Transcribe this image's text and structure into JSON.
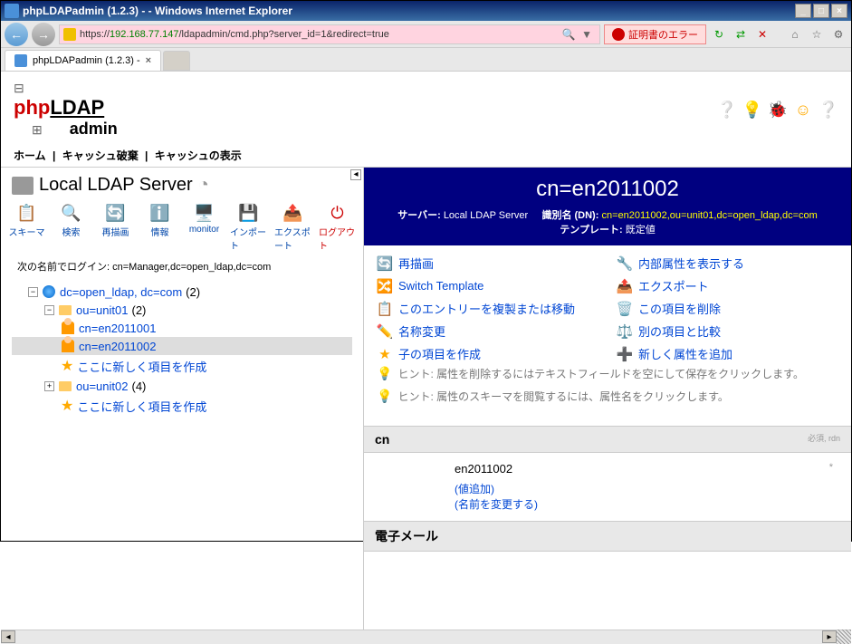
{
  "window": {
    "title": "phpLDAPadmin (1.2.3) -  - Windows Internet Explorer",
    "minimize": "_",
    "maximize": "□",
    "close": "×"
  },
  "nav": {
    "back": "←",
    "forward": "→",
    "url_prefix": "https://",
    "url_host": "192.168.77.147",
    "url_path": "/ldapadmin/cmd.php?server_id=1&redirect=true",
    "cert_error": "証明書のエラー"
  },
  "tab": {
    "title": "phpLDAPadmin (1.2.3) - ",
    "close": "×"
  },
  "logo": {
    "php": "php",
    "ldap": "LDAP",
    "admin": "admin"
  },
  "navlinks": {
    "home": "ホーム",
    "purge": "キャッシュ破棄",
    "show": "キャッシュの表示"
  },
  "server": {
    "title": "Local LDAP Server"
  },
  "toolbar": {
    "schema": "スキーマ",
    "search": "検索",
    "refresh": "再描画",
    "info": "情報",
    "monitor": "monitor",
    "import": "インポート",
    "export": "エクスポート",
    "logout": "ログアウト"
  },
  "login_info": "次の名前でログイン: cn=Manager,dc=open_ldap,dc=com",
  "tree": {
    "root": "dc=open_ldap, dc=com",
    "root_count": "(2)",
    "unit01": "ou=unit01",
    "unit01_count": "(2)",
    "cn1": "cn=en2011001",
    "cn2": "cn=en2011002",
    "create1": "ここに新しく項目を作成",
    "unit02": "ou=unit02",
    "unit02_count": "(4)",
    "create2": "ここに新しく項目を作成"
  },
  "dn": {
    "title": "cn=en2011002",
    "server_label": "サーバー:",
    "server_value": "Local LDAP Server",
    "dn_label": "識別名 (DN):",
    "dn_value": "cn=en2011002,ou=unit01,dc=open_ldap,dc=com",
    "template_label": "テンプレート:",
    "template_value": "既定値"
  },
  "actions": {
    "refresh": "再描画",
    "internal": "内部属性を表示する",
    "switch": "Switch Template",
    "export": "エクスポート",
    "copy": "このエントリーを複製または移動",
    "delete": "この項目を削除",
    "rename": "名称変更",
    "compare": "別の項目と比較",
    "child": "子の項目を作成",
    "addattr": "新しく属性を追加"
  },
  "hints": {
    "h1": "ヒント: 属性を削除するにはテキストフィールドを空にして保存をクリックします。",
    "h2": "ヒント: 属性のスキーマを閲覧するには、属性名をクリックします。"
  },
  "attrs": {
    "cn_label": "cn",
    "cn_meta": "必須, rdn",
    "cn_value": "en2011002",
    "cn_add": "(値追加)",
    "cn_rename": "(名前を変更する)",
    "email_label": "電子メール",
    "required": "*"
  }
}
